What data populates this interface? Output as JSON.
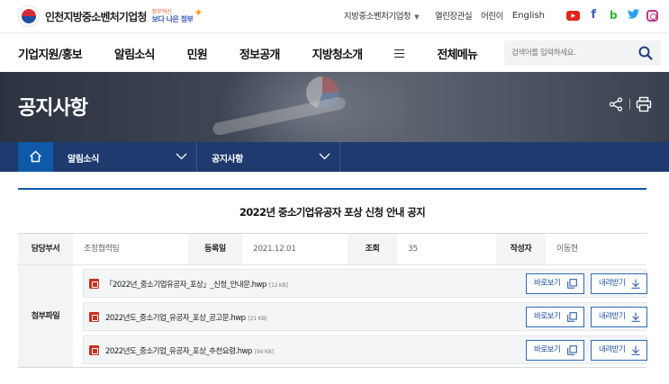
{
  "header": {
    "agency_name": "인천지방중소벤처기업청",
    "slogan_line1": "정부혁신",
    "slogan_line2": "보다 나은 정부",
    "org_select": "지방중소벤처기업청",
    "links": [
      "열린장관실",
      "어린이",
      "English"
    ],
    "sns": [
      "youtube-icon",
      "facebook-icon",
      "blog-icon",
      "twitter-icon",
      "instagram-icon"
    ]
  },
  "nav": {
    "items": [
      "기업지원/홍보",
      "알림소식",
      "민원",
      "정보공개",
      "지방청소개"
    ],
    "all_menu": "전체메뉴",
    "search_placeholder": "검색어를 입력하세요."
  },
  "banner": {
    "title": "공지사항"
  },
  "breadcrumb": {
    "level1": "알림소식",
    "level2": "공지사항"
  },
  "post": {
    "title": "2022년 중소기업유공자 포상 신청 안내 공지",
    "labels": {
      "dept": "담당부서",
      "date": "등록일",
      "views": "조회",
      "author": "작성자",
      "files": "첨부파일"
    },
    "dept": "조정협력팀",
    "date": "2021.12.01",
    "views": "35",
    "author": "이동현",
    "attachments": [
      {
        "name": "「2022년_중소기업유공자_포상」_신청_안내문.hwp",
        "size": "[12 KB]"
      },
      {
        "name": "2022년도_중소기업_유공자_포상_공고문.hwp",
        "size": "[21 KB]"
      },
      {
        "name": "2022년도_중소기업_유공자_포상_추천요령.hwp",
        "size": "[94 KB]"
      }
    ],
    "view_label": "바로보기",
    "download_label": "내려받기"
  },
  "colors": {
    "brand_blue": "#0e5aa8",
    "navy": "#1e3a6e",
    "hwp_red": "#c8311f"
  }
}
